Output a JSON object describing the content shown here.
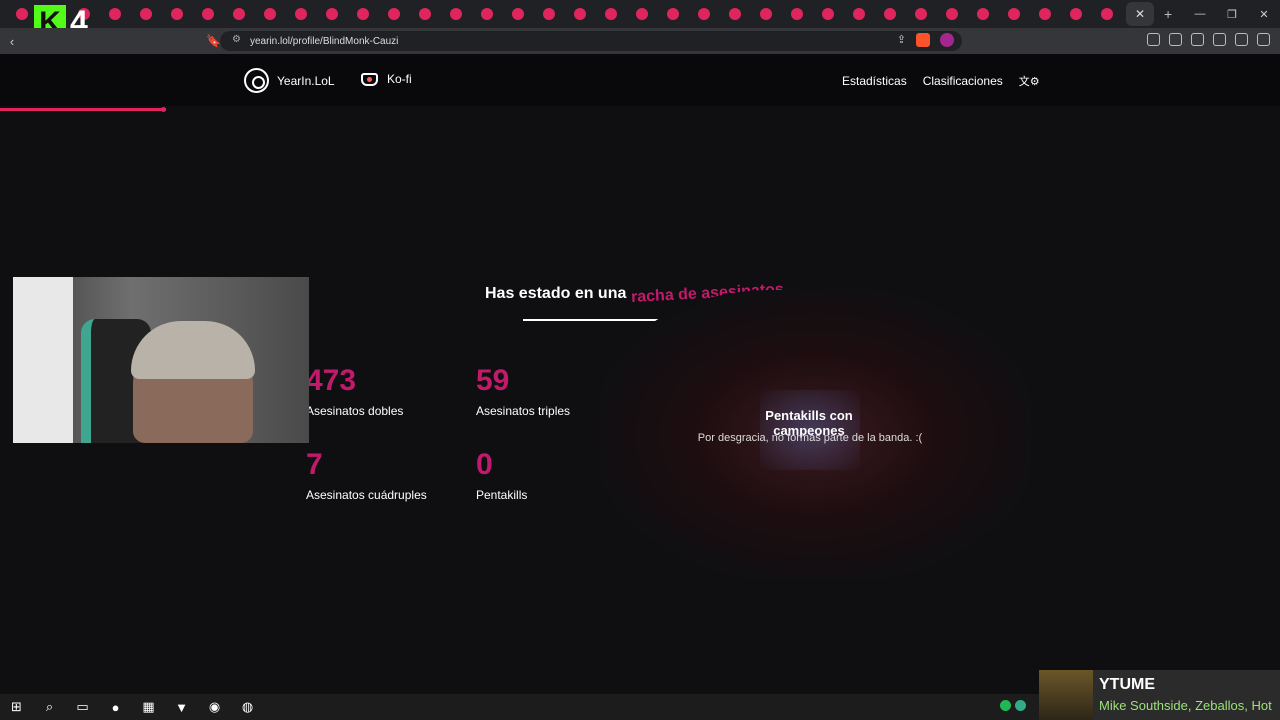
{
  "overlay": {
    "channel_logo_letter": "K",
    "channel_logo_number": "4"
  },
  "browser": {
    "tab_count": 36,
    "close_tab_icon": "close-icon",
    "new_tab_icon": "plus-icon",
    "url": "yearin.lol/profile/BlindMonk-Cauzi",
    "window_controls": [
      "minimize-icon",
      "restore-icon",
      "close-icon"
    ]
  },
  "site": {
    "brand": "YearIn.LoL",
    "kofi": "Ko-fi",
    "nav": {
      "stats": "Estadísticas",
      "rankings": "Clasificaciones"
    },
    "progress_fraction": 0.13,
    "accent_color": "#c21a6b"
  },
  "section": {
    "headline_prefix": "Has estado en una",
    "headline_accent": "racha de asesinatos"
  },
  "stats": [
    {
      "value": "473",
      "label": "Asesinatos dobles"
    },
    {
      "value": "59",
      "label": "Asesinatos triples"
    },
    {
      "value": "7",
      "label": "Asesinatos cuádruples"
    },
    {
      "value": "0",
      "label": "Pentakills"
    }
  ],
  "pentakills_card": {
    "title": "Pentakills con campeones",
    "subtitle": "Por desgracia, no formas parte de la banda. :("
  },
  "media": {
    "title": "YTUME",
    "artist": "Mike Southside, Zeballos, Hot"
  },
  "taskbar": [
    "windows-icon",
    "search-icon",
    "folder-icon",
    "spotify-icon",
    "store-icon",
    "brave-icon",
    "obs-icon",
    "discord-icon"
  ]
}
